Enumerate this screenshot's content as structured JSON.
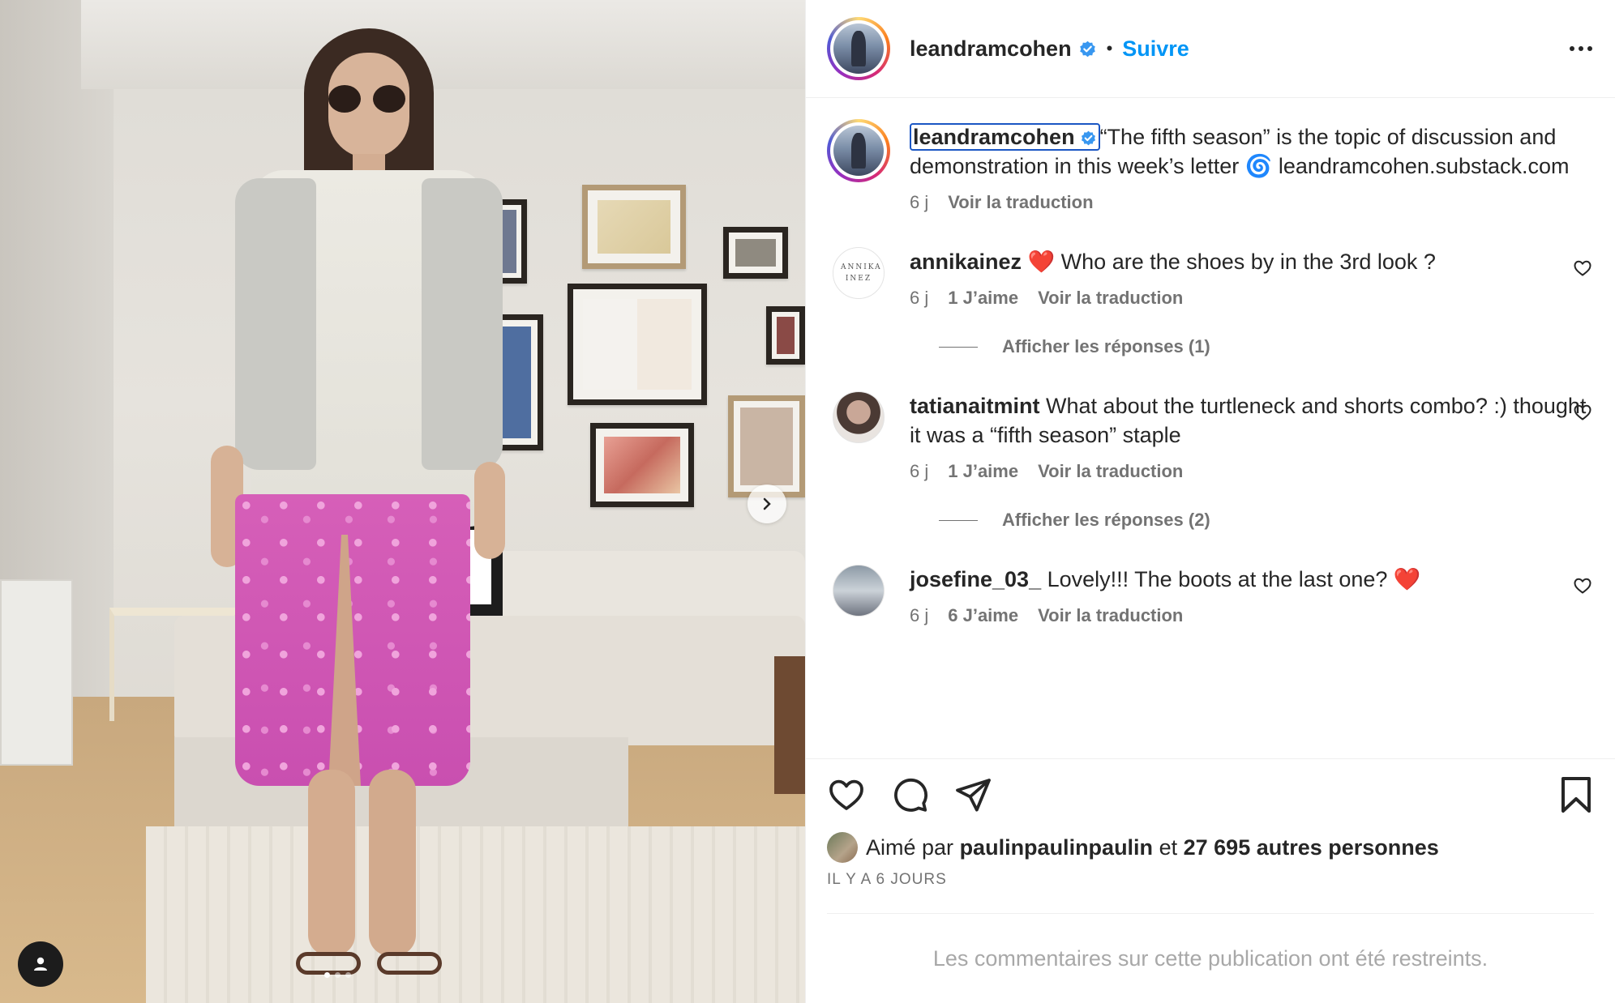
{
  "post": {
    "author": "leandramcohen",
    "follow_label": "Suivre",
    "separator": "•",
    "caption": "“The fifth season” is the topic of discussion and demonstration in this week’s letter 🌀 leandramcohen.substack.com",
    "caption_time": "6 j",
    "translate_label": "Voir la traduction"
  },
  "comments": [
    {
      "username": "annikainez",
      "avatar_text": "ANNIKA INEZ",
      "text": "❤️ Who are the shoes by in the 3rd look ?",
      "time": "6 j",
      "likes": "1 J’aime",
      "translate": "Voir la traduction",
      "replies": "Afficher les réponses (1)"
    },
    {
      "username": "tatianaitmint",
      "text": "What about the turtleneck and shorts combo? :) thought it was a “fifth season” staple",
      "time": "6 j",
      "likes": "1 J’aime",
      "translate": "Voir la traduction",
      "replies": "Afficher les réponses (2)"
    },
    {
      "username": "josefine_03_",
      "text": "Lovely!!! The boots at the last one? ❤️",
      "time": "6 j",
      "likes": "6 J’aime",
      "translate": "Voir la traduction"
    }
  ],
  "likes_line": {
    "prefix": "Aimé par",
    "user": "paulinpaulinpaulin",
    "middle": "et",
    "count": "27 695 autres personnes"
  },
  "date": "IL Y A 6 JOURS",
  "restricted": "Les commentaires sur cette publication ont été restreints.",
  "colors": {
    "accent": "#0095f6",
    "verified": "#3897f0",
    "secondary_text": "#737373"
  }
}
